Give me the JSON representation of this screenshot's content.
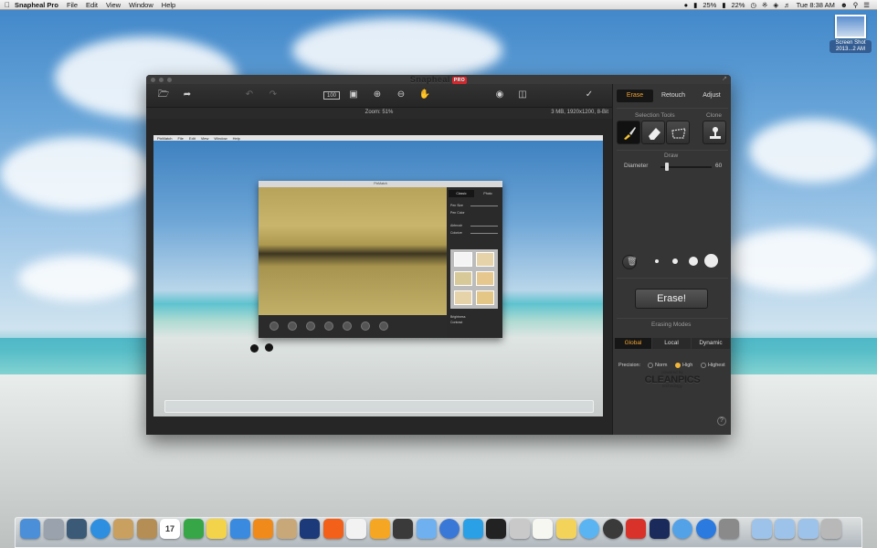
{
  "menubar": {
    "app": "Snapheal Pro",
    "items": [
      "File",
      "Edit",
      "View",
      "Window",
      "Help"
    ],
    "status": {
      "battery_a": "25%",
      "battery_b": "22%",
      "clock": "Tue 8:38 AM"
    }
  },
  "desktop_icon": {
    "label": "Screen Shot 2013...2 AM",
    "icon": "screenshot-file-icon"
  },
  "window": {
    "title": "Snapheal",
    "badge": "PRO",
    "zoom": "Zoom: 51%",
    "meta": "3 MB, 1920x1200, 8-Bit",
    "toolbar_icons": [
      "open-icon",
      "share-icon",
      "undo-icon",
      "redo-icon",
      "history-icon",
      "actual-size-icon",
      "fit-screen-icon",
      "zoom-in-icon",
      "zoom-out-icon",
      "hand-icon",
      "preview-eye-icon",
      "compare-icon",
      "crop-icon"
    ]
  },
  "inner_screenshot": {
    "menu": {
      "app": "PixMatch",
      "items": [
        "File",
        "Edit",
        "View",
        "Window",
        "Help"
      ]
    },
    "window_title": "PixMatch",
    "tabs": [
      "Classic",
      "Photo"
    ],
    "rows": [
      "Pen Size",
      "Pen Color",
      "Airbrush",
      "Colorize"
    ],
    "bottom_rows": [
      "Brightness",
      "Contrast"
    ]
  },
  "panel": {
    "tabs": [
      {
        "label": "Erase",
        "active": true
      },
      {
        "label": "Retouch",
        "active": false
      },
      {
        "label": "Adjust",
        "active": false
      }
    ],
    "selection_tools_label": "Selection Tools",
    "clone_label": "Clone",
    "draw_label": "Draw",
    "diameter_label": "Diameter",
    "diameter_value": "60",
    "diameter_level": 0.1,
    "erase_button": "Erase!",
    "erasing_modes_label": "Erasing Modes",
    "modes": [
      {
        "label": "Global",
        "active": true
      },
      {
        "label": "Local",
        "active": false
      },
      {
        "label": "Dynamic",
        "active": false
      }
    ],
    "precision_label": "Precision:",
    "precision": [
      {
        "label": "Norm",
        "selected": false
      },
      {
        "label": "High",
        "selected": true
      },
      {
        "label": "Highest",
        "selected": false
      }
    ],
    "brand": {
      "powered": "powered by",
      "name": "CLEANPICS",
      "tech": "technology"
    },
    "help": "?"
  },
  "dock": {
    "icons": [
      "finder-icon",
      "launchpad-icon",
      "dashboard-icon",
      "safari-icon",
      "preview-icon",
      "contacts-icon",
      "calendar-icon",
      "evernote-icon",
      "stickies-icon",
      "pixelmator-icon",
      "vlc-icon",
      "tableau-icon",
      "snapheal-icon",
      "soundcloud-icon",
      "inkscape-icon",
      "pen-icon",
      "witch-icon",
      "mailbox-icon",
      "chrome-icon",
      "twitter-icon",
      "console-icon",
      "image-capture-icon",
      "textedit-icon",
      "notes-icon",
      "messages-icon",
      "quicktime-icon",
      "photo-booth-icon",
      "photoshop-icon",
      "itunes-icon",
      "app-store-icon",
      "system-preferences-icon",
      "applications-folder-icon",
      "documents-folder-icon",
      "downloads-folder-icon",
      "trash-icon"
    ],
    "calendar_day": "17"
  }
}
